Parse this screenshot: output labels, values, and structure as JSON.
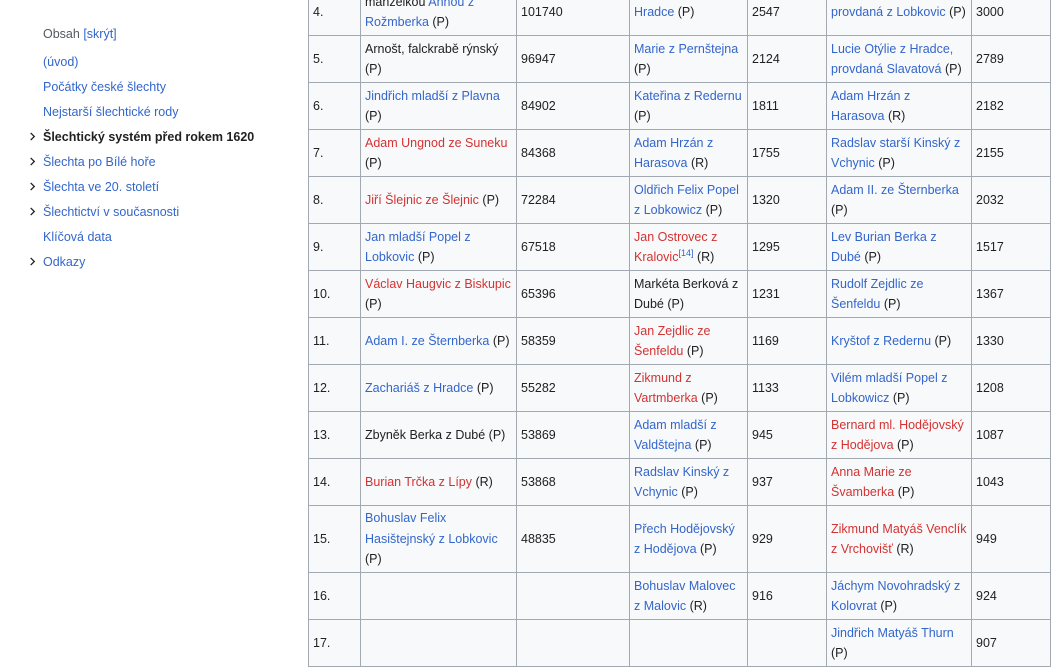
{
  "toc": {
    "title": "Obsah",
    "toggle": "[skrýt]",
    "items": [
      {
        "label": "(úvod)",
        "expandable": false,
        "current": false
      },
      {
        "label": "Počátky české šlechty",
        "expandable": false,
        "current": false
      },
      {
        "label": "Nejstarší šlechtické rody",
        "expandable": false,
        "current": false
      },
      {
        "label": "Šlechtický systém před rokem 1620",
        "expandable": true,
        "current": true
      },
      {
        "label": "Šlechta po Bílé hoře",
        "expandable": true,
        "current": false
      },
      {
        "label": "Šlechta ve 20. století",
        "expandable": true,
        "current": false
      },
      {
        "label": "Šlechtictví v současnosti",
        "expandable": true,
        "current": false
      },
      {
        "label": "Klíčová data",
        "expandable": false,
        "current": false
      },
      {
        "label": "Odkazy",
        "expandable": true,
        "current": false
      }
    ]
  },
  "table": {
    "rows": [
      {
        "rank": "4.",
        "lines": 2,
        "c1": [
          {
            "t": "manželkou ",
            "c": "dark"
          },
          {
            "t": "Annou z Rožmberka",
            "c": "blue"
          },
          {
            "t": " (P)",
            "c": "dark"
          }
        ],
        "v1": "101740",
        "c2": [
          {
            "t": "Hradce",
            "c": "blue"
          },
          {
            "t": " (P)",
            "c": "dark"
          }
        ],
        "v2": "2547",
        "c3": [
          {
            "t": "provdaná z Lobkovic",
            "c": "blue"
          },
          {
            "t": " (P)",
            "c": "dark"
          }
        ],
        "v3": "3000"
      },
      {
        "rank": "5.",
        "lines": 2,
        "c1": [
          {
            "t": "Arnošt, falckrabě rýnský (P)",
            "c": "dark"
          }
        ],
        "v1": "96947",
        "c2": [
          {
            "t": "Marie z Pernštejna",
            "c": "blue"
          },
          {
            "t": " (P)",
            "c": "dark"
          }
        ],
        "v2": "2124",
        "c3": [
          {
            "t": "Lucie Otýlie z Hradce, provdaná Slavatová",
            "c": "blue"
          },
          {
            "t": " (P)",
            "c": "dark"
          }
        ],
        "v3": "2789"
      },
      {
        "rank": "6.",
        "lines": 2,
        "c1": [
          {
            "t": "Jindřich mladší z Plavna",
            "c": "blue"
          },
          {
            "t": " (P)",
            "c": "dark"
          }
        ],
        "v1": "84902",
        "c2": [
          {
            "t": "Kateřina z Redernu",
            "c": "blue"
          },
          {
            "t": " (P)",
            "c": "dark"
          }
        ],
        "v2": "1811",
        "c3": [
          {
            "t": "Adam Hrzán z Harasova",
            "c": "blue"
          },
          {
            "t": " (R)",
            "c": "dark"
          }
        ],
        "v3": "2182"
      },
      {
        "rank": "7.",
        "lines": 2,
        "c1": [
          {
            "t": "Adam Ungnod ze Suneku",
            "c": "red"
          },
          {
            "t": " (P)",
            "c": "dark"
          }
        ],
        "v1": "84368",
        "c2": [
          {
            "t": "Adam Hrzán z Harasova",
            "c": "blue"
          },
          {
            "t": " (R)",
            "c": "dark"
          }
        ],
        "v2": "1755",
        "c3": [
          {
            "t": "Radslav starší Kinský z Vchynic",
            "c": "blue"
          },
          {
            "t": " (P)",
            "c": "dark"
          }
        ],
        "v3": "2155"
      },
      {
        "rank": "8.",
        "lines": 2,
        "c1": [
          {
            "t": "Jiří Šlejnic ze Šlejnic",
            "c": "red"
          },
          {
            "t": " (P)",
            "c": "dark"
          }
        ],
        "v1": "72284",
        "c2": [
          {
            "t": "Oldřich Felix Popel z Lobkowicz",
            "c": "blue"
          },
          {
            "t": " (P)",
            "c": "dark"
          }
        ],
        "v2": "1320",
        "c3": [
          {
            "t": "Adam II. ze Šternberka",
            "c": "blue"
          },
          {
            "t": " (P)",
            "c": "dark"
          }
        ],
        "v3": "2032"
      },
      {
        "rank": "9.",
        "lines": 2,
        "c1": [
          {
            "t": "Jan mladší Popel z Lobkovic",
            "c": "blue"
          },
          {
            "t": " (P)",
            "c": "dark"
          }
        ],
        "v1": "67518",
        "c2": [
          {
            "t": "Jan Ostrovec z Kralovic",
            "c": "red"
          },
          {
            "t": "[14]",
            "c": "blue",
            "sup": true
          },
          {
            "t": " (R)",
            "c": "dark"
          }
        ],
        "v2": "1295",
        "c3": [
          {
            "t": "Lev Burian Berka z Dubé",
            "c": "blue"
          },
          {
            "t": " (P)",
            "c": "dark"
          }
        ],
        "v3": "1517"
      },
      {
        "rank": "10.",
        "lines": 2,
        "c1": [
          {
            "t": "Václav Haugvic z Biskupic",
            "c": "red"
          },
          {
            "t": " (P)",
            "c": "dark"
          }
        ],
        "v1": "65396",
        "c2": [
          {
            "t": "Markéta Berková z Dubé (P)",
            "c": "dark"
          }
        ],
        "v2": "1231",
        "c3": [
          {
            "t": "Rudolf Zejdlic ze Šenfeldu",
            "c": "blue"
          },
          {
            "t": " (P)",
            "c": "dark"
          }
        ],
        "v3": "1367"
      },
      {
        "rank": "11.",
        "lines": 2,
        "c1": [
          {
            "t": "Adam I. ze Šternberka",
            "c": "blue"
          },
          {
            "t": " (P)",
            "c": "dark"
          }
        ],
        "v1": "58359",
        "c2": [
          {
            "t": "Jan Zejdlic ze Šenfeldu",
            "c": "red"
          },
          {
            "t": " (P)",
            "c": "dark"
          }
        ],
        "v2": "1169",
        "c3": [
          {
            "t": "Kryštof z Redernu",
            "c": "blue"
          },
          {
            "t": " (P)",
            "c": "dark"
          }
        ],
        "v3": "1330"
      },
      {
        "rank": "12.",
        "lines": 2,
        "c1": [
          {
            "t": "Zachariáš z Hradce",
            "c": "blue"
          },
          {
            "t": " (P)",
            "c": "dark"
          }
        ],
        "v1": "55282",
        "c2": [
          {
            "t": "Zikmund z Vartmberka",
            "c": "red"
          },
          {
            "t": " (P)",
            "c": "dark"
          }
        ],
        "v2": "1133",
        "c3": [
          {
            "t": "Vilém mladší Popel z Lobkowicz",
            "c": "blue"
          },
          {
            "t": " (P)",
            "c": "dark"
          }
        ],
        "v3": "1208"
      },
      {
        "rank": "13.",
        "lines": 2,
        "c1": [
          {
            "t": "Zbyněk Berka z Dubé (P)",
            "c": "dark"
          }
        ],
        "v1": "53869",
        "c2": [
          {
            "t": "Adam mladší z Valdštejna",
            "c": "blue"
          },
          {
            "t": " (P)",
            "c": "dark"
          }
        ],
        "v2": "945",
        "c3": [
          {
            "t": "Bernard ml. Hodějovský z Hodějova",
            "c": "red"
          },
          {
            "t": " (P)",
            "c": "dark"
          }
        ],
        "v3": "1087"
      },
      {
        "rank": "14.",
        "lines": 2,
        "c1": [
          {
            "t": "Burian Trčka z Lípy",
            "c": "red"
          },
          {
            "t": " (R)",
            "c": "dark"
          }
        ],
        "v1": "53868",
        "c2": [
          {
            "t": "Radslav Kinský z Vchynic",
            "c": "blue"
          },
          {
            "t": " (P)",
            "c": "dark"
          }
        ],
        "v2": "937",
        "c3": [
          {
            "t": "Anna Marie ze Švamberka",
            "c": "red"
          },
          {
            "t": " (P)",
            "c": "dark"
          }
        ],
        "v3": "1043"
      },
      {
        "rank": "15.",
        "lines": 3,
        "c1": [
          {
            "t": "Bohuslav Felix Hasištejnský z Lobkovic",
            "c": "blue"
          },
          {
            "t": " (P)",
            "c": "dark"
          }
        ],
        "v1": "48835",
        "c2": [
          {
            "t": "Přech Hodějovský z Hodějova",
            "c": "blue"
          },
          {
            "t": " (P)",
            "c": "dark"
          }
        ],
        "v2": "929",
        "c3": [
          {
            "t": "Zikmund Matyáš Venclík z Vrchovišť",
            "c": "red"
          },
          {
            "t": " (R)",
            "c": "dark"
          }
        ],
        "v3": "949"
      },
      {
        "rank": "16.",
        "lines": 2,
        "c1": [],
        "v1": "",
        "c2": [
          {
            "t": "Bohuslav Malovec z Malovic",
            "c": "blue"
          },
          {
            "t": " (R)",
            "c": "dark"
          }
        ],
        "v2": "916",
        "c3": [
          {
            "t": "Jáchym Novohradský z Kolovrat",
            "c": "blue"
          },
          {
            "t": " (P)",
            "c": "dark"
          }
        ],
        "v3": "924"
      },
      {
        "rank": "17.",
        "lines": 2,
        "c1": [],
        "v1": "",
        "c2": [],
        "v2": "",
        "c3": [
          {
            "t": "Jindřich Matyáš Thurn",
            "c": "blue"
          },
          {
            "t": " (P)",
            "c": "dark"
          }
        ],
        "v3": "907"
      }
    ]
  }
}
